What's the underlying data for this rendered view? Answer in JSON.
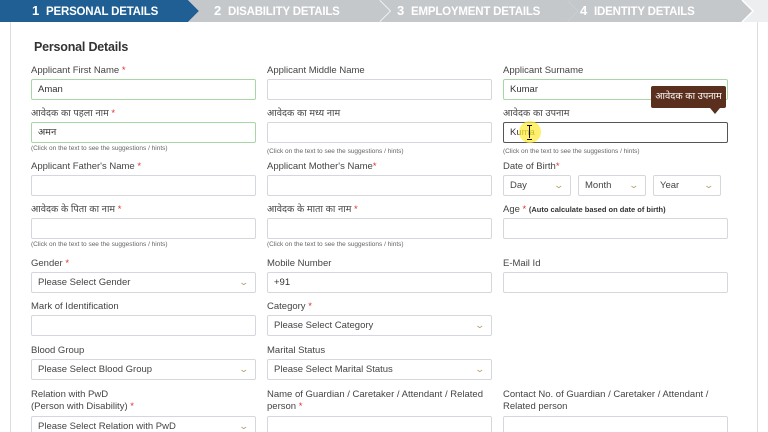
{
  "stepper": {
    "steps": [
      {
        "number": "1",
        "label": "PERSONAL DETAILS"
      },
      {
        "number": "2",
        "label": "DISABILITY DETAILS"
      },
      {
        "number": "3",
        "label": "EMPLOYMENT DETAILS"
      },
      {
        "number": "4",
        "label": "IDENTITY DETAILS"
      }
    ],
    "active_color": "#1f5f93",
    "inactive_color": "#c4c8cb"
  },
  "form": {
    "title": "Personal Details",
    "hint_text": "(Click on the text to see the suggestions / hints)",
    "first_name": {
      "label": "Applicant First Name",
      "value": "Aman"
    },
    "middle_name": {
      "label": "Applicant Middle Name",
      "value": ""
    },
    "surname": {
      "label": "Applicant Surname",
      "value": "Kumar"
    },
    "first_name_hi": {
      "label": "आवेदक का पहला नाम",
      "value": "अमन"
    },
    "middle_name_hi": {
      "label": "आवेदक का मध्य नाम",
      "value": ""
    },
    "surname_hi": {
      "label": "आवेदक का उपनाम",
      "value": "Kuma",
      "tooltip": "आवेदक का उपनाम"
    },
    "father_name": {
      "label": "Applicant Father's Name",
      "value": ""
    },
    "mother_name": {
      "label": "Applicant Mother's Name",
      "value": ""
    },
    "dob": {
      "label": "Date of Birth",
      "day": "Day",
      "month": "Month",
      "year": "Year"
    },
    "father_name_hi": {
      "label": "आवेदक के पिता का नाम",
      "value": ""
    },
    "mother_name_hi": {
      "label": "आवेदक के माता का नाम",
      "value": ""
    },
    "age": {
      "label": "Age",
      "note": "(Auto calculate based on date of birth)",
      "value": ""
    },
    "gender": {
      "label": "Gender",
      "value": "Please Select Gender"
    },
    "mobile": {
      "label": "Mobile Number",
      "prefix": "+91"
    },
    "email": {
      "label": "E-Mail Id",
      "value": ""
    },
    "identification_mark": {
      "label": "Mark of Identification",
      "value": ""
    },
    "category": {
      "label": "Category",
      "value": "Please Select Category"
    },
    "blood_group": {
      "label": "Blood Group",
      "value": "Please Select Blood Group"
    },
    "marital_status": {
      "label": "Marital Status",
      "value": "Please Select Marital Status"
    },
    "relation_pwd": {
      "label_line1": "Relation with PwD",
      "label_line2": "(Person with Disability)",
      "value": "Please Select Relation with PwD"
    },
    "guardian_name": {
      "label_line1": "Name of Guardian / Caretaker / Attendant / Related",
      "label_line2": "person"
    },
    "guardian_contact": {
      "label_line1": "Contact No. of Guardian / Caretaker / Attendant /",
      "label_line2": "Related person"
    },
    "required_mark": "*"
  }
}
